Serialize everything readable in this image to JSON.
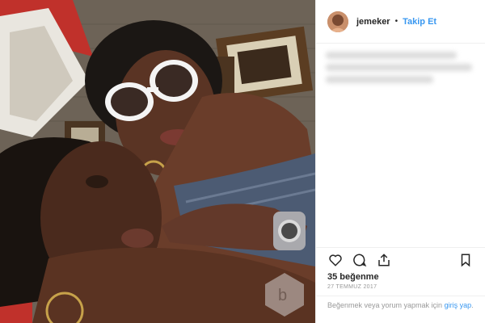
{
  "post": {
    "username": "jemeker",
    "separator": "•",
    "follow_label": "Takip Et",
    "likes": "35 beğenme",
    "date": "27 TEMMUZ 2017",
    "login_prompt": "Beğenmek veya yorum yapmak için",
    "login_link": "giriş yap",
    "login_end": "."
  },
  "icons": {
    "like": "heart-icon",
    "comment": "comment-icon",
    "share": "share-icon",
    "save": "bookmark-icon"
  },
  "colors": {
    "link": "#3897f0",
    "text": "#262626",
    "muted": "#999999"
  }
}
